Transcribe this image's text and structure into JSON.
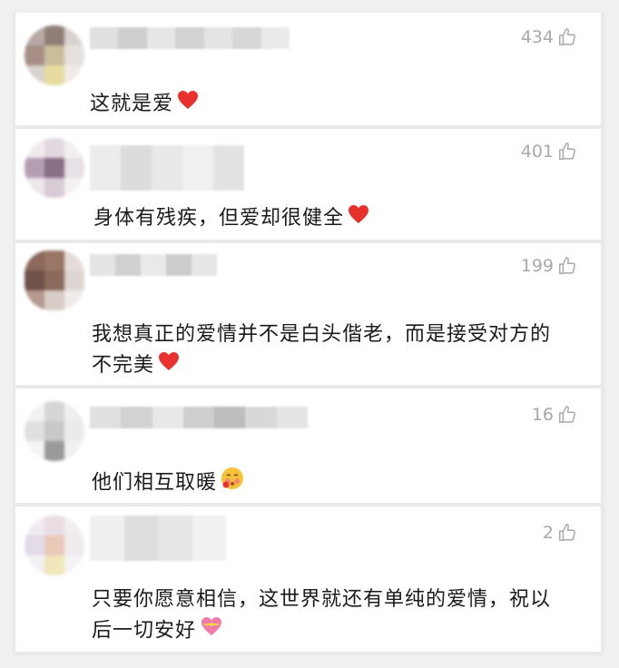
{
  "comments": [
    {
      "likes": "434",
      "text": "这就是爱",
      "emoji": "heart-icon"
    },
    {
      "likes": "401",
      "text": "身体有残疾，但爱却很健全",
      "emoji": "heart-icon"
    },
    {
      "likes": "199",
      "text_line1": "我想真正的爱情并不是白头偕老，而是接受对方的",
      "text_line2": "不完美",
      "emoji": "heart-icon"
    },
    {
      "likes": "16",
      "text": "他们相互取暖",
      "emoji": "blushing-face-icon"
    },
    {
      "likes": "2",
      "text_line1": "只要你愿意相信，这世界就还有单纯的爱情，祝以",
      "text_line2": "后一切安好",
      "emoji": "heart-with-ribbon-icon"
    }
  ],
  "colors": {
    "like_gray": "#a8a8a8",
    "text": "#1a1a1a",
    "heart_red": "#e8312c",
    "divider": "#e9e9e9"
  }
}
